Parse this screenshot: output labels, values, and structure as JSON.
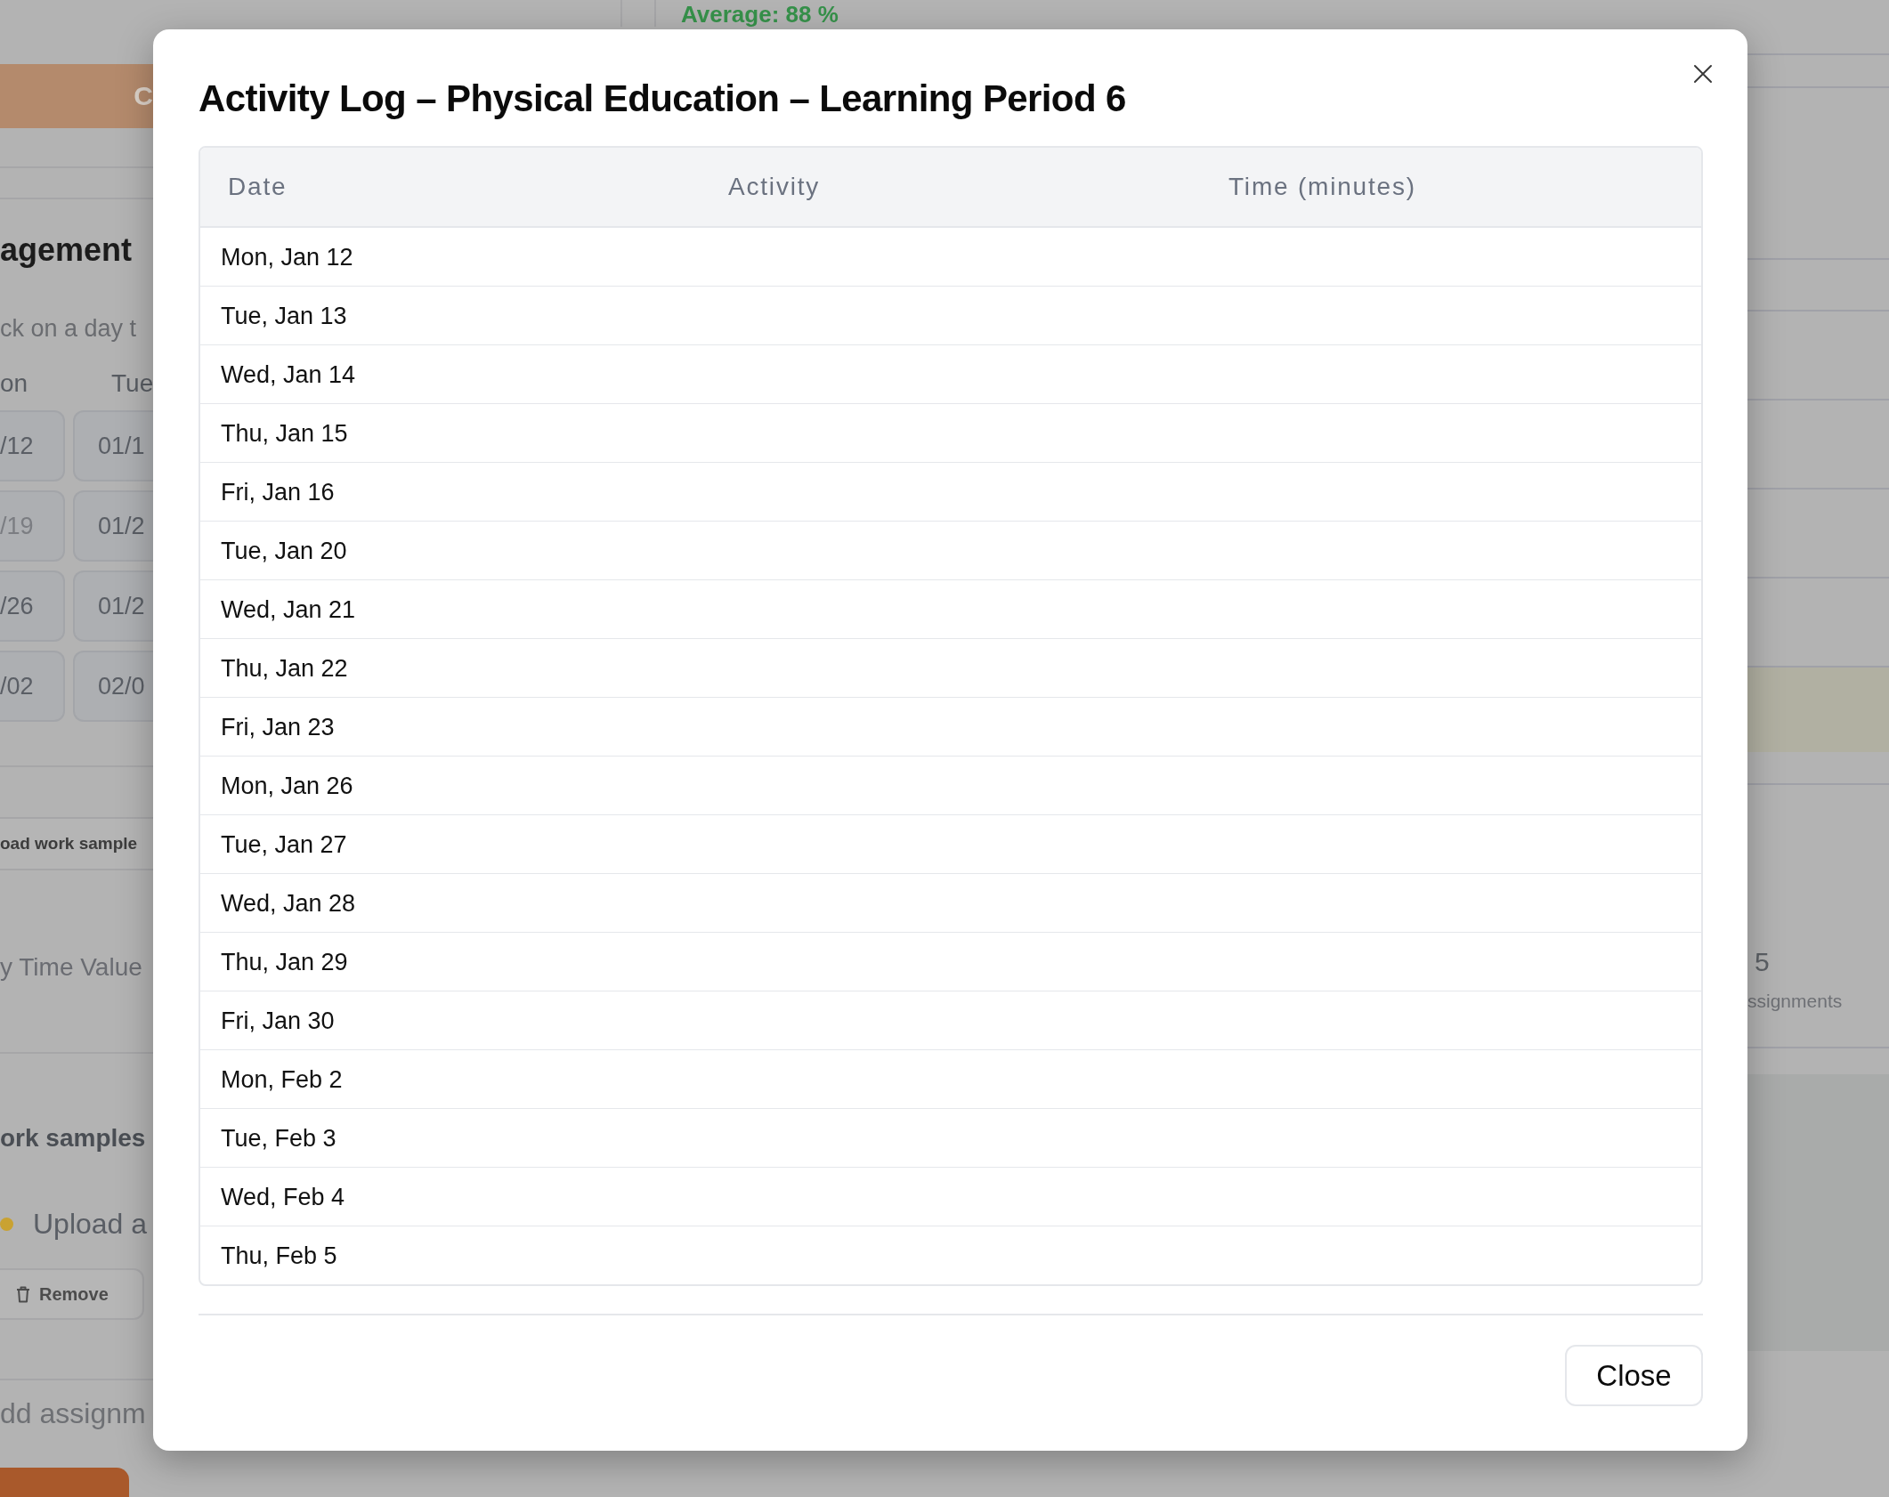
{
  "background": {
    "average": "Average: 88 %",
    "left": {
      "top_button": "C",
      "heading": "agement",
      "hint": "ck on a day t",
      "weekdays": [
        "on",
        "Tue"
      ],
      "calendar_rows": [
        [
          {
            "label": "/12",
            "muted": false
          },
          {
            "label": "01/1",
            "muted": false
          }
        ],
        [
          {
            "label": "/19",
            "muted": true
          },
          {
            "label": "01/2",
            "muted": false
          }
        ],
        [
          {
            "label": "/26",
            "muted": false
          },
          {
            "label": "01/2",
            "muted": false
          }
        ],
        [
          {
            "label": "/02",
            "muted": false
          },
          {
            "label": "02/0",
            "muted": false
          }
        ]
      ],
      "upload_button": "oad work sample",
      "time_label": "y Time Value",
      "samples_heading": "ork samples",
      "upload_prompt": "Upload a",
      "remove_button": "Remove",
      "add_assignment": "dd assignm"
    },
    "right": {
      "count": "5",
      "count_label": "ssignments"
    }
  },
  "dialog": {
    "title": "Activity Log – Physical Education – Learning Period 6",
    "table": {
      "columns": [
        "Date",
        "Activity",
        "Time (minutes)"
      ],
      "rows": [
        {
          "date": "Mon, Jan 12"
        },
        {
          "date": "Tue, Jan 13"
        },
        {
          "date": "Wed, Jan 14"
        },
        {
          "date": "Thu, Jan 15"
        },
        {
          "date": "Fri, Jan 16"
        },
        {
          "date": "Tue, Jan 20"
        },
        {
          "date": "Wed, Jan 21"
        },
        {
          "date": "Thu, Jan 22"
        },
        {
          "date": "Fri, Jan 23"
        },
        {
          "date": "Mon, Jan 26"
        },
        {
          "date": "Tue, Jan 27"
        },
        {
          "date": "Wed, Jan 28"
        },
        {
          "date": "Thu, Jan 29"
        },
        {
          "date": "Fri, Jan 30"
        },
        {
          "date": "Mon, Feb 2"
        },
        {
          "date": "Tue, Feb 3"
        },
        {
          "date": "Wed, Feb 4"
        },
        {
          "date": "Thu, Feb 5"
        }
      ]
    },
    "buttons": [
      "Close"
    ]
  }
}
